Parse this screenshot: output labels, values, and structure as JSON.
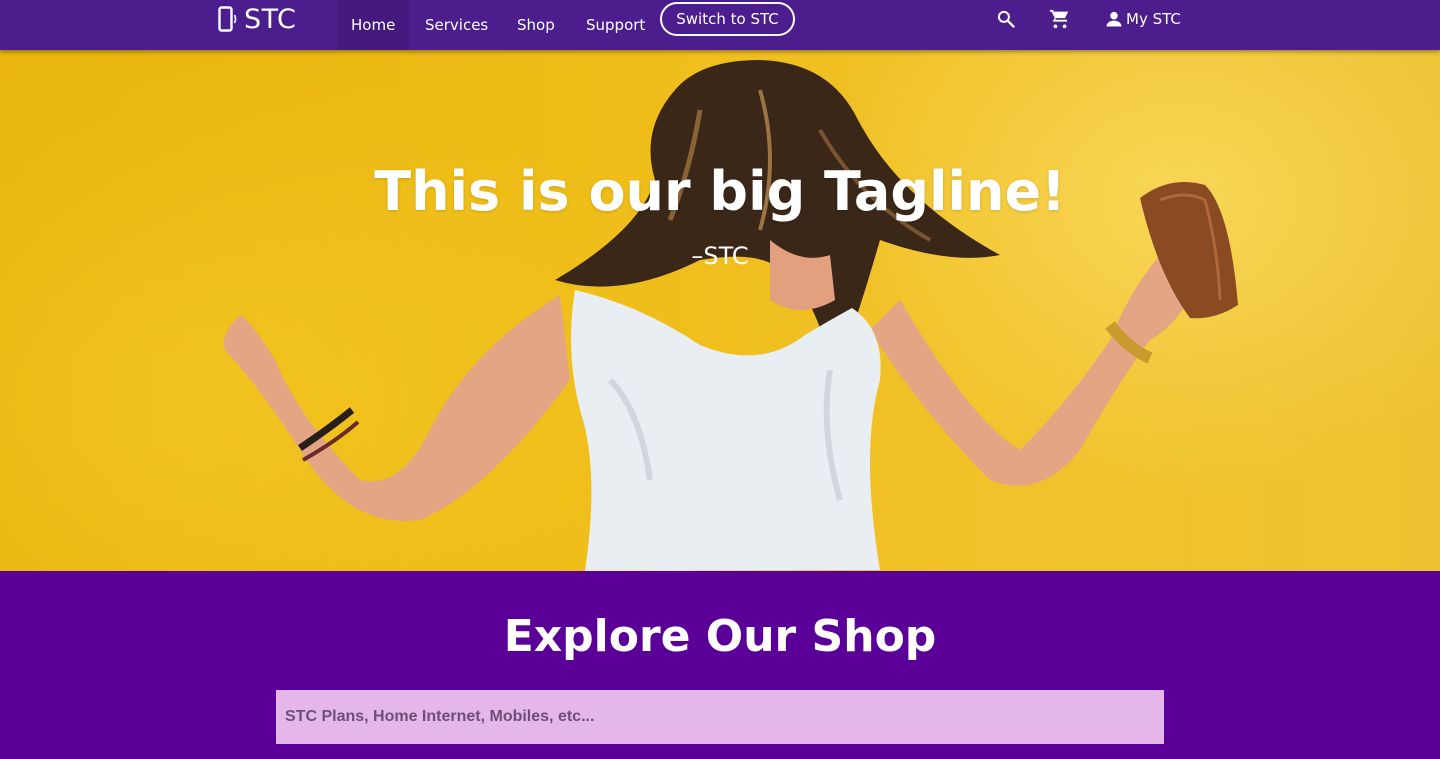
{
  "colors": {
    "nav_bg": "#4c1d8c",
    "nav_active_bg": "#451a7e",
    "hero_bg": "#f0bf1f",
    "shop_bg": "#5a0099",
    "search_bg": "#e5b6ea",
    "text_light": "#ffffff"
  },
  "nav": {
    "logo": {
      "icon": "phone-signal-icon",
      "text": "STC"
    },
    "links": [
      {
        "label": "Home",
        "active": true
      },
      {
        "label": "Services",
        "active": false
      },
      {
        "label": "Shop",
        "active": false
      },
      {
        "label": "Support",
        "active": false
      }
    ],
    "switch_label": "Switch to STC",
    "search_icon": "search-icon",
    "cart_icon": "cart-icon",
    "account": {
      "icon": "person-icon",
      "label": "My STC"
    }
  },
  "hero": {
    "image": "woman-dancing-yellow-wall-photo",
    "tagline": "This is our big Tagline!",
    "attribution": "–STC"
  },
  "shop": {
    "title": "Explore Our Shop",
    "search_placeholder": "STC Plans, Home Internet, Mobiles, etc..."
  }
}
